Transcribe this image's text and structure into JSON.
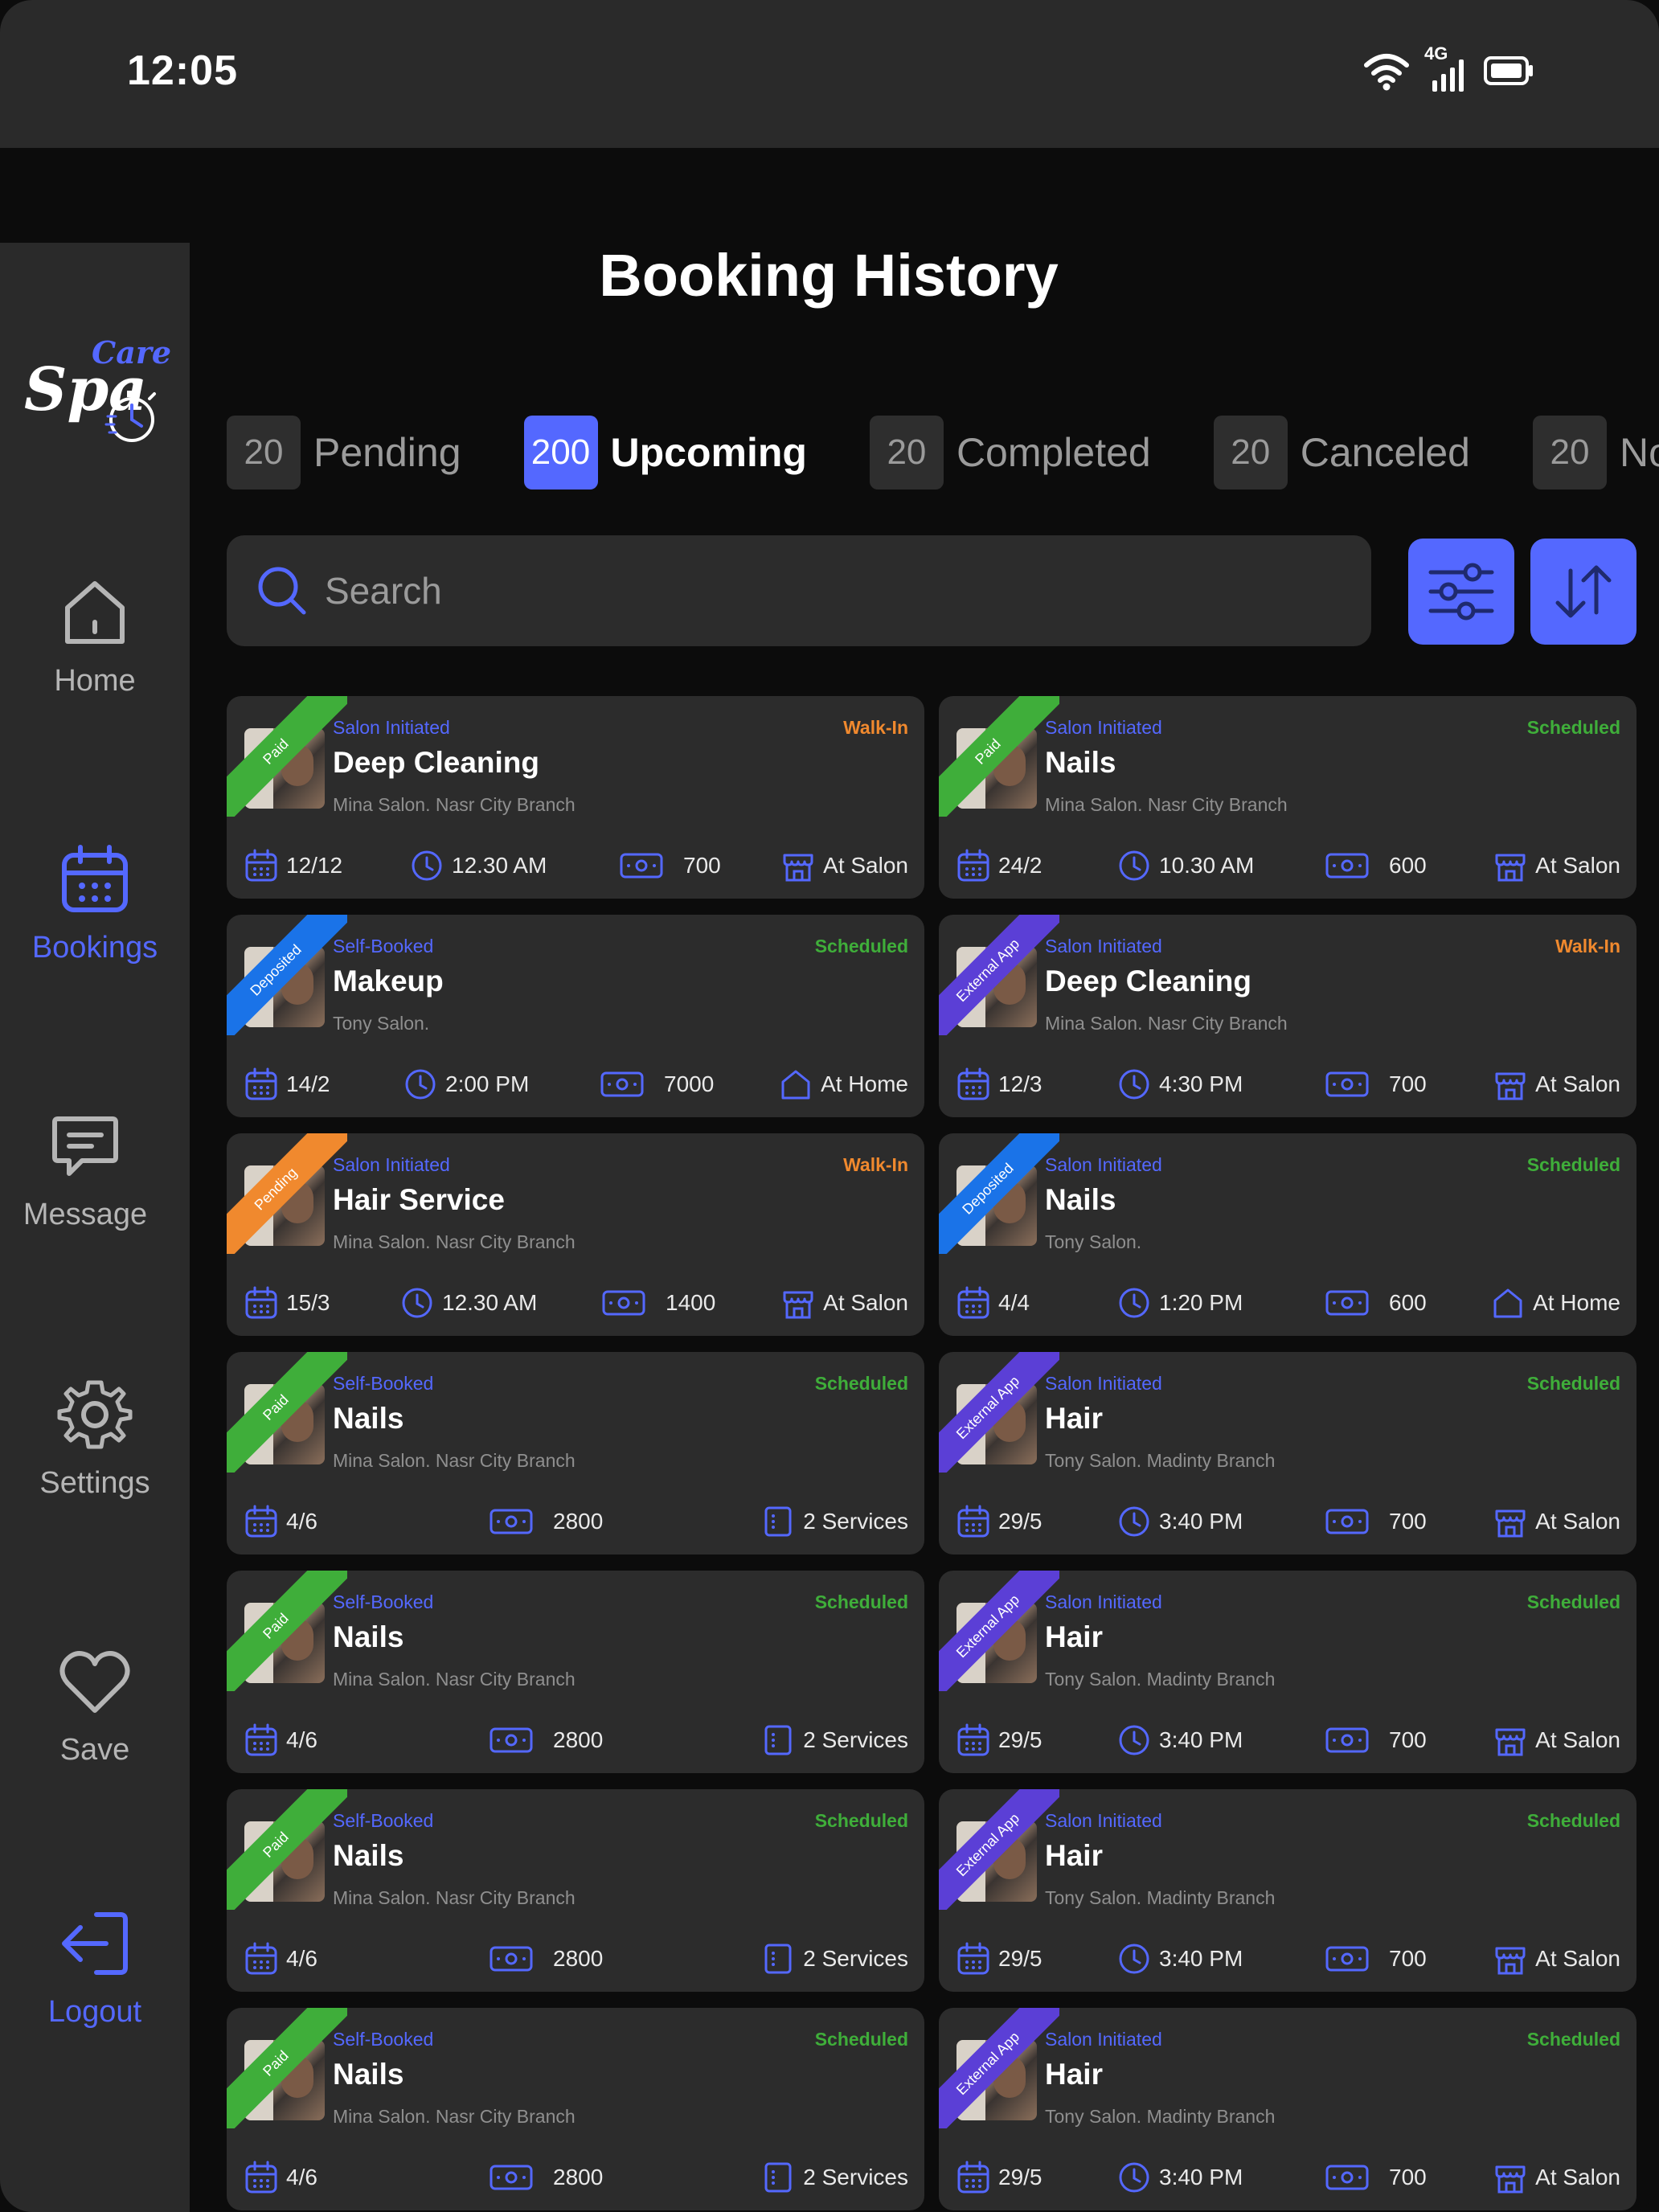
{
  "status_bar": {
    "time": "12:05",
    "network": "4G"
  },
  "sidebar": {
    "logo": {
      "top": "Care",
      "main": "Spa"
    },
    "items": [
      {
        "label": "Home",
        "icon": "home-icon",
        "active": false
      },
      {
        "label": "Bookings",
        "icon": "calendar-icon",
        "active": true
      },
      {
        "label": "Message",
        "icon": "message-icon",
        "active": false
      },
      {
        "label": "Settings",
        "icon": "gear-icon",
        "active": false
      },
      {
        "label": "Save",
        "icon": "heart-icon",
        "active": false
      },
      {
        "label": "Logout",
        "icon": "logout-icon",
        "active": false
      }
    ]
  },
  "page": {
    "title": "Booking History"
  },
  "tabs": [
    {
      "count": "20",
      "label": "Pending",
      "active": false
    },
    {
      "count": "200",
      "label": "Upcoming",
      "active": true
    },
    {
      "count": "20",
      "label": "Completed",
      "active": false
    },
    {
      "count": "20",
      "label": "Canceled",
      "active": false
    },
    {
      "count": "20",
      "label": "No Show",
      "active": false
    }
  ],
  "search": {
    "placeholder": "Search"
  },
  "toolbar": {
    "filter_icon": "sliders-icon",
    "sort_icon": "sort-arrows-icon"
  },
  "colors": {
    "accent": "#5468ff",
    "paid": "#3fae3a",
    "deposited": "#1a73e8",
    "external": "#5b3fd6",
    "pending": "#f0892e",
    "walkin": "#f0892e",
    "scheduled": "#3fae3a"
  },
  "bookings": [
    {
      "badge": "Paid",
      "type": "Salon Initiated",
      "status": "Walk-In",
      "title": "Deep Cleaning",
      "subtitle": "Mina Salon. Nasr City Branch",
      "date": "12/12",
      "time": "12.30 AM",
      "price": "700",
      "location": "At Salon"
    },
    {
      "badge": "Paid",
      "type": "Salon Initiated",
      "status": "Scheduled",
      "title": "Nails",
      "subtitle": "Mina Salon. Nasr City Branch",
      "date": "24/2",
      "time": "10.30 AM",
      "price": "600",
      "location": "At Salon"
    },
    {
      "badge": "Deposited",
      "type": "Self-Booked",
      "status": "Scheduled",
      "title": "Makeup",
      "subtitle": "Tony Salon.",
      "date": "14/2",
      "time": "2:00 PM",
      "price": "7000",
      "location": "At Home"
    },
    {
      "badge": "External App",
      "type": "Salon Initiated",
      "status": "Walk-In",
      "title": "Deep Cleaning",
      "subtitle": "Mina Salon. Nasr City Branch",
      "date": "12/3",
      "time": "4:30 PM",
      "price": "700",
      "location": "At Salon"
    },
    {
      "badge": "Pending",
      "type": "Salon Initiated",
      "status": "Walk-In",
      "title": "Hair Service",
      "subtitle": "Mina Salon. Nasr City Branch",
      "date": "15/3",
      "time": "12.30 AM",
      "price": "1400",
      "location": "At Salon"
    },
    {
      "badge": "Deposited",
      "type": "Salon Initiated",
      "status": "Scheduled",
      "title": "Nails",
      "subtitle": "Tony Salon.",
      "date": "4/4",
      "time": "1:20 PM",
      "price": "600",
      "location": "At Home"
    },
    {
      "badge": "Paid",
      "type": "Self-Booked",
      "status": "Scheduled",
      "title": "Nails",
      "subtitle": "Mina Salon. Nasr City Branch",
      "date": "4/6",
      "price": "2800",
      "services": "2 Services"
    },
    {
      "badge": "External App",
      "type": "Salon Initiated",
      "status": "Scheduled",
      "title": "Hair",
      "subtitle": "Tony Salon. Madinty Branch",
      "date": "29/5",
      "time": "3:40 PM",
      "price": "700",
      "location": "At Salon"
    },
    {
      "badge": "Paid",
      "type": "Self-Booked",
      "status": "Scheduled",
      "title": "Nails",
      "subtitle": "Mina Salon. Nasr City Branch",
      "date": "4/6",
      "price": "2800",
      "services": "2 Services"
    },
    {
      "badge": "External App",
      "type": "Salon Initiated",
      "status": "Scheduled",
      "title": "Hair",
      "subtitle": "Tony Salon. Madinty Branch",
      "date": "29/5",
      "time": "3:40 PM",
      "price": "700",
      "location": "At Salon"
    },
    {
      "badge": "Paid",
      "type": "Self-Booked",
      "status": "Scheduled",
      "title": "Nails",
      "subtitle": "Mina Salon. Nasr City Branch",
      "date": "4/6",
      "price": "2800",
      "services": "2 Services"
    },
    {
      "badge": "External App",
      "type": "Salon Initiated",
      "status": "Scheduled",
      "title": "Hair",
      "subtitle": "Tony Salon. Madinty Branch",
      "date": "29/5",
      "time": "3:40 PM",
      "price": "700",
      "location": "At Salon"
    },
    {
      "badge": "Paid",
      "type": "Self-Booked",
      "status": "Scheduled",
      "title": "Nails",
      "subtitle": "Mina Salon. Nasr City Branch",
      "date": "4/6",
      "price": "2800",
      "services": "2 Services"
    },
    {
      "badge": "External App",
      "type": "Salon Initiated",
      "status": "Scheduled",
      "title": "Hair",
      "subtitle": "Tony Salon. Madinty Branch",
      "date": "29/5",
      "time": "3:40 PM",
      "price": "700",
      "location": "At Salon"
    }
  ]
}
